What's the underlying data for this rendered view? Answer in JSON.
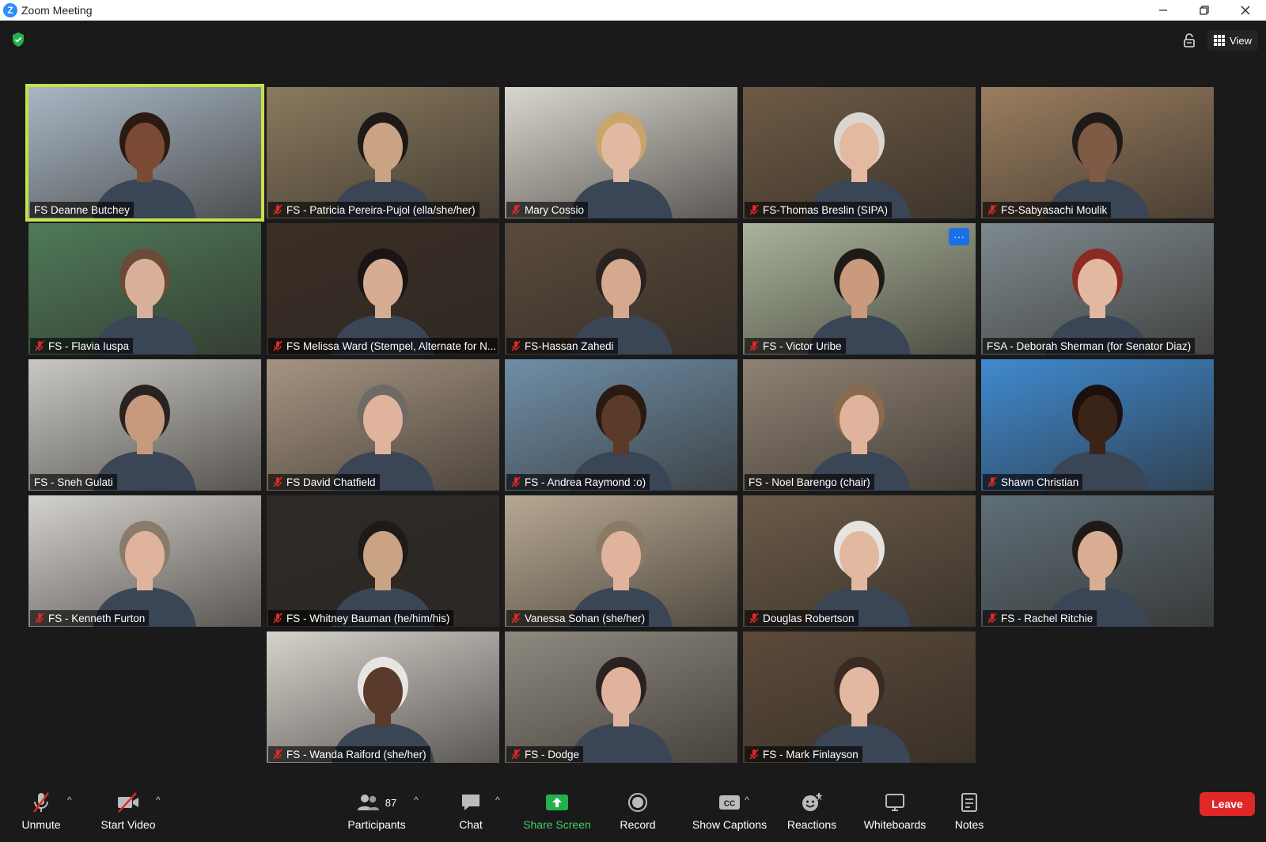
{
  "window": {
    "title": "Zoom Meeting"
  },
  "topbar": {
    "view_label": "View"
  },
  "participants": [
    {
      "name": "FS Deanne Butchey",
      "muted": false,
      "active": true,
      "bg": "#a8b7c4",
      "skin": "#7a4a34",
      "hair": "#2b1a12"
    },
    {
      "name": "FS - Patricia Pereira-Pujol (ella/she/her)",
      "muted": true,
      "bg": "#8a7a5e",
      "skin": "#c9a383",
      "hair": "#1e1a18"
    },
    {
      "name": "Mary Cossio",
      "muted": true,
      "bg": "#d8d6cf",
      "skin": "#e0b9a0",
      "hair": "#c9a46b"
    },
    {
      "name": "FS-Thomas Breslin (SIPA)",
      "muted": true,
      "bg": "#6d5a44",
      "skin": "#e3b9a0",
      "hair": "#d9d6d0"
    },
    {
      "name": "FS-Sabyasachi Moulik",
      "muted": true,
      "bg": "#9a7d5f",
      "skin": "#7f5a44",
      "hair": "#1e1a18"
    },
    {
      "name": "FS - Flavia Iuspa",
      "muted": true,
      "bg": "#4f7a5a",
      "skin": "#d9b09a",
      "hair": "#6b4a38"
    },
    {
      "name": "FS Melissa Ward (Stempel, Alternate for N...",
      "muted": true,
      "bg": "#3b2f26",
      "skin": "#d6ad92",
      "hair": "#1a1414"
    },
    {
      "name": "FS-Hassan Zahedi",
      "muted": true,
      "bg": "#5a4a3c",
      "skin": "#d4a98e",
      "hair": "#2a2220"
    },
    {
      "name": "FS - Victor Uribe",
      "muted": true,
      "bg": "#a9b39a",
      "skin": "#c99a7c",
      "hair": "#1e1a18",
      "more": true
    },
    {
      "name": "FSA - Deborah Sherman (for Senator Diaz)",
      "muted": false,
      "bg": "#7e8a8f",
      "skin": "#e2b8a0",
      "hair": "#8b2a22"
    },
    {
      "name": "FS - Sneh Gulati",
      "muted": false,
      "bg": "#c9c8c2",
      "skin": "#c79a7e",
      "hair": "#2a2220"
    },
    {
      "name": "FS David Chatfield",
      "muted": true,
      "bg": "#a69482",
      "skin": "#e0b49c",
      "hair": "#6e6a66"
    },
    {
      "name": "FS - Andrea Raymond :o)",
      "muted": true,
      "bg": "#6f8fa8",
      "skin": "#5a3a28",
      "hair": "#2a1a12"
    },
    {
      "name": "FS - Noel Barengo (chair)",
      "muted": false,
      "bg": "#8f8274",
      "skin": "#e0b49c",
      "hair": "#8a6a4e"
    },
    {
      "name": "Shawn Christian",
      "muted": true,
      "bg": "#3f8ad0",
      "skin": "#3a2418",
      "hair": "#1a1010"
    },
    {
      "name": "FS - Kenneth Furton",
      "muted": true,
      "bg": "#d4d2cc",
      "skin": "#e0b49c",
      "hair": "#8a7a6a"
    },
    {
      "name": "FS - Whitney Bauman (he/him/his)",
      "muted": true,
      "bg": "#2e2a26",
      "skin": "#c9a383",
      "hair": "#1e1a18"
    },
    {
      "name": "Vanessa Sohan (she/her)",
      "muted": true,
      "bg": "#b7a892",
      "skin": "#e0b49c",
      "hair": "#8a7a66"
    },
    {
      "name": "Douglas Robertson",
      "muted": true,
      "bg": "#6b5a48",
      "skin": "#e2b8a0",
      "hair": "#e6e4e0"
    },
    {
      "name": "FS - Rachel Ritchie",
      "muted": true,
      "bg": "#5f6f78",
      "skin": "#d9ad92",
      "hair": "#1e1a18"
    },
    {
      "name": "FS - Wanda Raiford (she/her)",
      "muted": true,
      "bg": "#d6d2cc",
      "skin": "#5a3a2a",
      "hair": "#e8e6e2"
    },
    {
      "name": "FS - Dodge",
      "muted": true,
      "bg": "#8f8a80",
      "skin": "#e0b49c",
      "hair": "#2a2220"
    },
    {
      "name": "FS - Mark Finlayson",
      "muted": true,
      "bg": "#5c4a3a",
      "skin": "#e2b8a0",
      "hair": "#3a2a22"
    }
  ],
  "toolbar": {
    "unmute": "Unmute",
    "start_video": "Start Video",
    "participants": "Participants",
    "participants_count": "87",
    "chat": "Chat",
    "share_screen": "Share Screen",
    "record": "Record",
    "show_captions": "Show Captions",
    "reactions": "Reactions",
    "whiteboards": "Whiteboards",
    "notes": "Notes",
    "leave": "Leave"
  },
  "colors": {
    "active_speaker": "#c6e24b",
    "share_green": "#3fcf6a",
    "leave_red": "#e02828",
    "mute_red": "#e02828"
  }
}
